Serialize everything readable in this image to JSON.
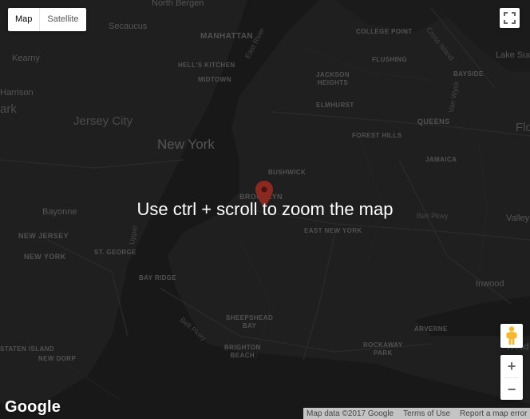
{
  "map_type": {
    "map_label": "Map",
    "satellite_label": "Satellite",
    "selected": "Map"
  },
  "places": {
    "north_bergen": "North Bergen",
    "secaucus": "Secaucus",
    "manhattan": "MANHATTAN",
    "college_point": "COLLEGE POINT",
    "kearny": "Kearny",
    "east_river": "East River",
    "flushing": "FLUSHING",
    "harrison": "Harrison",
    "ark": "ark",
    "hells_kitchen": "HELL'S KITCHEN",
    "midtown": "MIDTOWN",
    "jackson_heights": "JACKSON\nHEIGHTS",
    "bayside": "BAYSIDE",
    "lake_suc": "Lake Suc",
    "jersey_city": "Jersey City",
    "elmhurst": "ELMHURST",
    "queens": "QUEENS",
    "flo": "Flo",
    "new_york": "New York",
    "forest_hills": "FOREST HILLS",
    "jamaica": "JAMAICA",
    "bushwick": "BUSHWICK",
    "brooklyn": "BROOKLYN",
    "bayonne": "Bayonne",
    "belt_pkwy_1": "Belt Pkwy",
    "valley": "Valley",
    "new_jersey": "NEW JERSEY",
    "upper": "Upper",
    "east_new_york": "EAST NEW YORK",
    "st_george": "ST. GEORGE",
    "new_york_state": "NEW YORK",
    "bay_ridge": "BAY RIDGE",
    "inwood": "Inwood",
    "sheepshead_bay": "SHEEPSHEAD\nBAY",
    "belt_pkwy_2": "Belt Pkwy",
    "arverne": "ARVERNE",
    "woodmere": "Wood",
    "staten_island": "STATEN ISLAND",
    "new_dorp": "NEW DORP",
    "brighton_beach": "BRIGHTON\nBEACH",
    "rockaway_park": "ROCKAWAY\nPARK",
    "cross_island": "Cross Island",
    "van_wyck": "Van Wyck"
  },
  "gesture_message": "Use ctrl + scroll to zoom the map",
  "logo": "Google",
  "attribution": {
    "map_data": "Map data ©2017 Google",
    "terms": "Terms of Use",
    "report": "Report a map error"
  },
  "zoom": {
    "in": "+",
    "out": "−"
  },
  "colors": {
    "land": "#232323",
    "water": "#1a1a1a",
    "road": "#2f2f2f",
    "pin": "#8b2820",
    "logo": "#ffffff"
  }
}
